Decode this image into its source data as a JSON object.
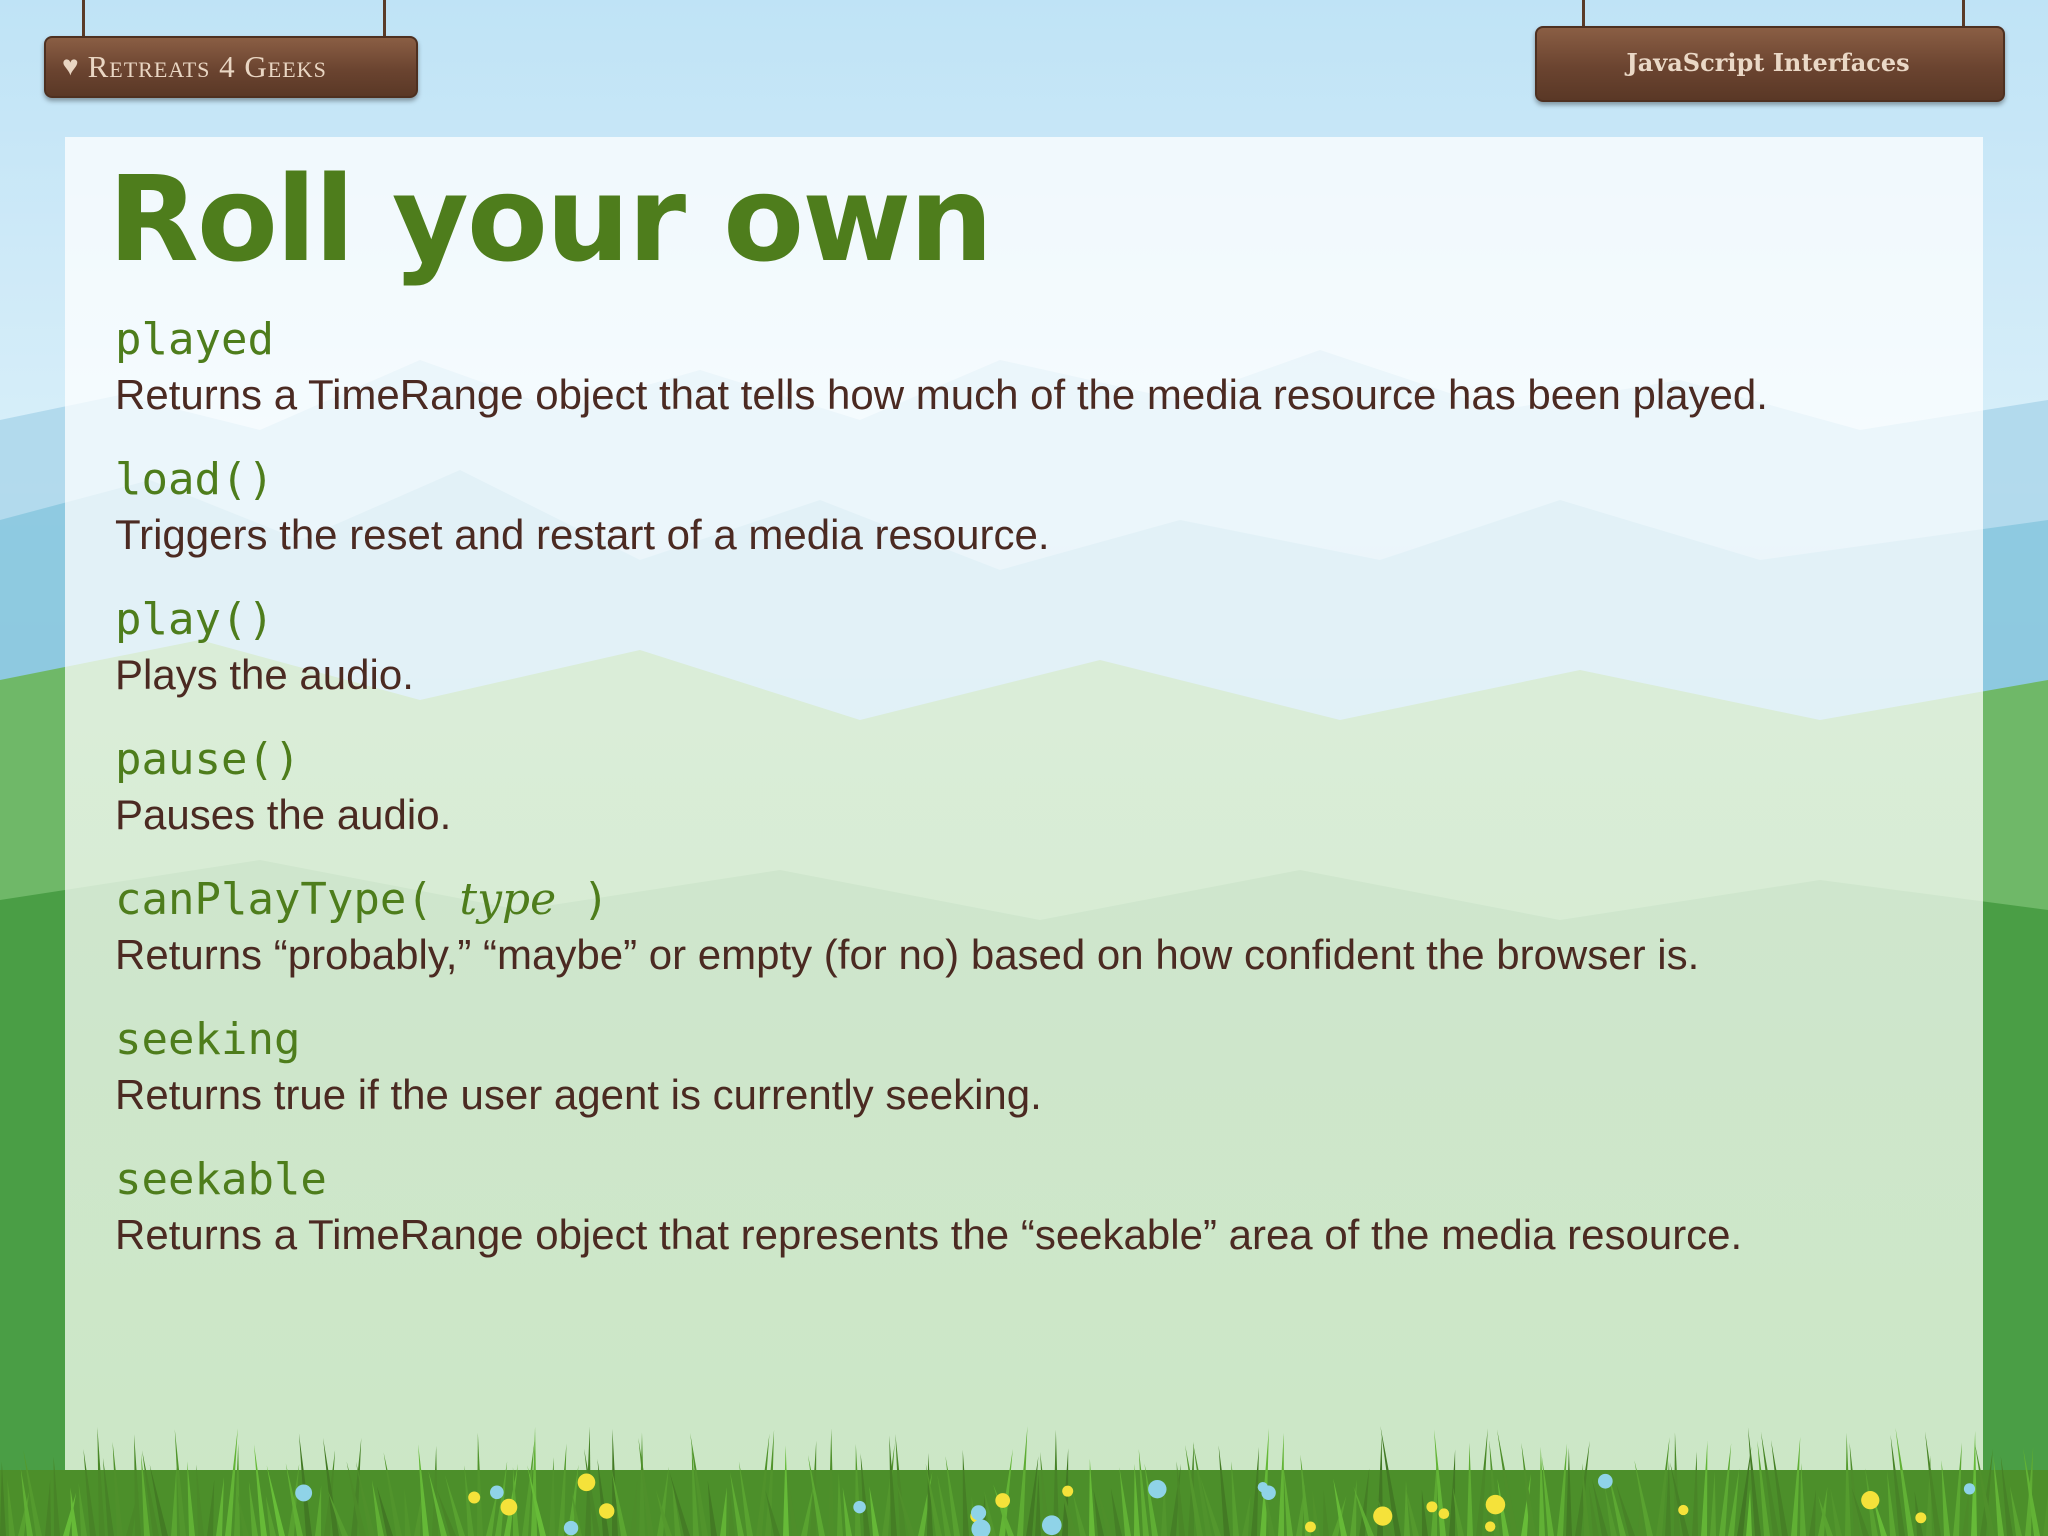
{
  "header": {
    "brand": "Retreats 4 Geeks",
    "topic": "JavaScript Interfaces"
  },
  "slide": {
    "title": "Roll your own",
    "entries": [
      {
        "term": "played",
        "arg": "",
        "term_end": "",
        "desc": "Returns a TimeRange object that tells how much of the media resource has been played."
      },
      {
        "term": "load()",
        "arg": "",
        "term_end": "",
        "desc": "Triggers the reset and restart of a media resource."
      },
      {
        "term": "play()",
        "arg": "",
        "term_end": "",
        "desc": "Plays the audio."
      },
      {
        "term": "pause()",
        "arg": "",
        "term_end": "",
        "desc": "Pauses the audio."
      },
      {
        "term": "canPlayType(",
        "arg": "type",
        "term_end": ")",
        "desc": "Returns “probably,” “maybe” or empty (for no) based on how confident the browser is."
      },
      {
        "term": "seeking",
        "arg": "",
        "term_end": "",
        "desc": "Returns true if the user agent is currently seeking."
      },
      {
        "term": "seekable",
        "arg": "",
        "term_end": "",
        "desc": "Returns a TimeRange object that represents the “seekable” area of the media resource."
      }
    ]
  },
  "colors": {
    "title_green": "#4e7d1c",
    "body_brown": "#4b2a22",
    "sign_wood": "#6b4430"
  },
  "icons": {
    "brand_icon": "heart-icon"
  }
}
